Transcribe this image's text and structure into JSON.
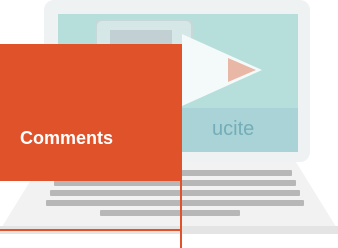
{
  "panel": {
    "label": "Comments",
    "color": "#e0522a"
  },
  "brand": {
    "partial_text": "ucite",
    "color": "#4a8fa0"
  },
  "illustration": {
    "icon": "laptop-icon",
    "screen_icon": "play-icon",
    "pencil_icon": "pencil-icon"
  }
}
